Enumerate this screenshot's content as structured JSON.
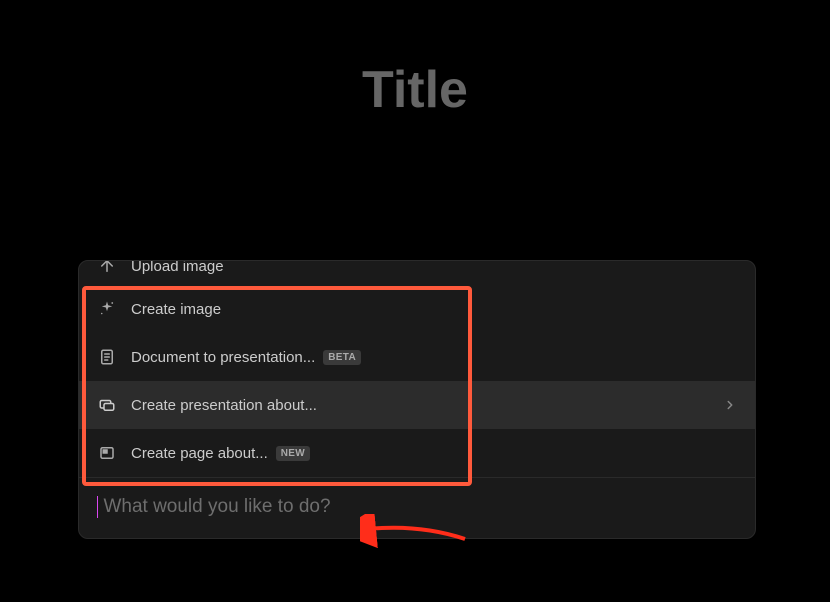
{
  "page": {
    "title_placeholder": "Title"
  },
  "menu": {
    "items": [
      {
        "label": "Upload image"
      },
      {
        "label": "Create image"
      },
      {
        "label": "Document to presentation...",
        "badge": "BETA"
      },
      {
        "label": "Create presentation about..."
      },
      {
        "label": "Create page about...",
        "badge": "NEW"
      }
    ]
  },
  "input": {
    "placeholder": "What would you like to do?"
  }
}
